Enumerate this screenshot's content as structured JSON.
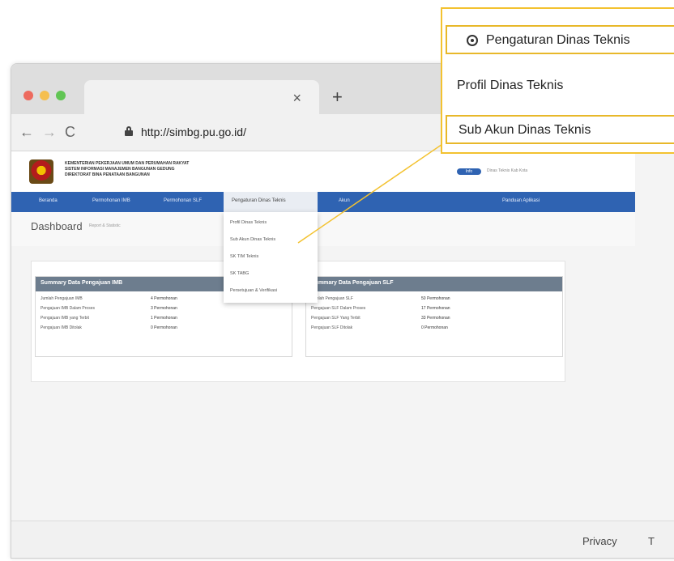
{
  "browser": {
    "new_tab": "+",
    "tab_close": "×",
    "nav": {
      "back": "←",
      "forward": "→",
      "reload": "C"
    },
    "url": "http://simbg.pu.go.id/"
  },
  "site": {
    "org_lines": [
      "KEMENTERIAN PEKERJAAN UMUM DAN PERUMAHAN RAKYAT",
      "SISTEM INFORMASI MANAJEMEN BANGUNAN GEDUNG",
      "DIREKTORAT BINA PENATAAN BANGUNAN"
    ],
    "user_badge": "Info",
    "user_name": "Dinas Teknis Kab Kota",
    "nav": [
      "Beranda",
      "Permohonan IMB",
      "Permohonan SLF",
      "Pengaturan Dinas Teknis",
      "Akun",
      "Panduan Aplikasi"
    ],
    "dashboard_title": "Dashboard",
    "dashboard_sub": "Report & Statistic",
    "dropdown": [
      "Profil Dinas Teknis",
      "Sub Akun Dinas Teknis",
      "SK TIM Teknis",
      "SK TABG",
      "Persetujuan & Verifikasi"
    ],
    "panels": [
      {
        "title": "Summary Data Pengajuan IMB",
        "rows": [
          {
            "label": "Jumlah Pengajuan IMB",
            "value": "4 Permohonan"
          },
          {
            "label": "Pengajuan IMB Dalam Proses",
            "value": "3 Permohonan"
          },
          {
            "label": "Pengajuan IMB yang Terbit",
            "value": "1 Permohonan"
          },
          {
            "label": "Pengajuan IMB Ditolak",
            "value": "0 Permohonan"
          }
        ]
      },
      {
        "title": "Summary Data Pengajuan SLF",
        "rows": [
          {
            "label": "Jumlah Pengajuan SLF",
            "value": "50 Permohonan"
          },
          {
            "label": "Pengajuan SLF Dalam Proses",
            "value": "17 Permohonan"
          },
          {
            "label": "Pengajuan SLF Yang Terbit",
            "value": "33 Permohonan"
          },
          {
            "label": "Pengajuan SLF Ditolak",
            "value": "0 Permohonan"
          }
        ]
      }
    ],
    "footer_privacy": "Privacy",
    "footer_t": "T"
  },
  "callout": {
    "header": "Pengaturan Dinas Teknis",
    "item1": "Profil Dinas Teknis",
    "item2": "Sub Akun Dinas Teknis"
  },
  "colors": {
    "accent": "#f3c230",
    "navbar": "#2f63b2",
    "panel_header": "#6d7d8e"
  }
}
